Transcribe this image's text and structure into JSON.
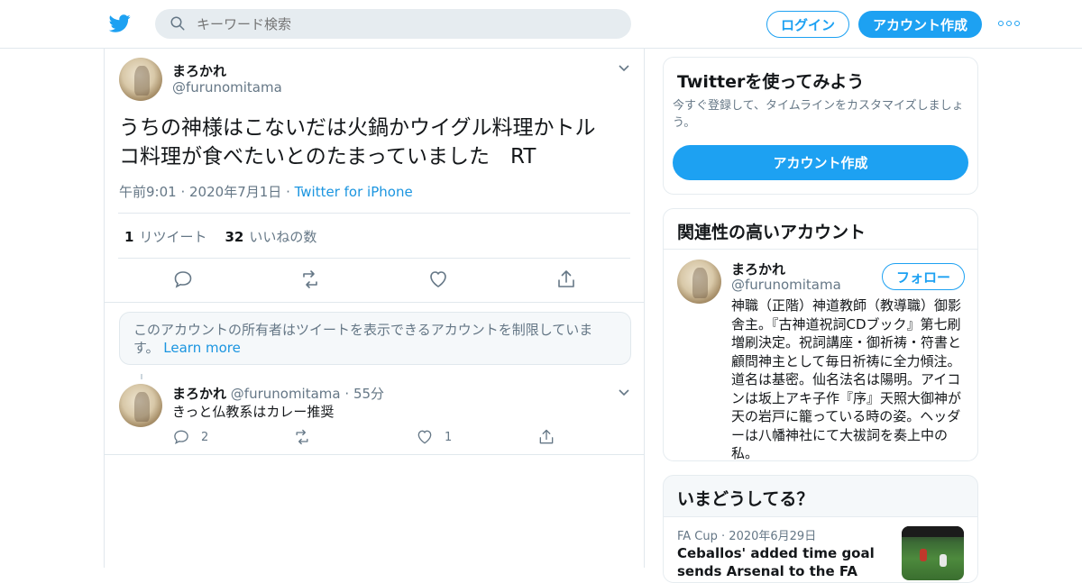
{
  "header": {
    "search_placeholder": "キーワード検索",
    "login_label": "ログイン",
    "signup_label": "アカウント作成"
  },
  "tweet": {
    "name": "まろかれ",
    "handle": "@furunomitama",
    "text_line1": "うちの神様はこないだは火鍋かウイグル料理かトル",
    "text_line2": "コ料理が食べたいとのたまっていました　RT",
    "time": "午前9:01",
    "date": "2020年7月1日",
    "source": "Twitter for iPhone",
    "retweet_count": "1",
    "retweet_label": "リツイート",
    "like_count": "32",
    "like_label": "いいねの数"
  },
  "notice": {
    "text": "このアカウントの所有者はツイートを表示できるアカウントを制限していま す。",
    "link": "Learn more"
  },
  "reply": {
    "name": "まろかれ",
    "handle": "@furunomitama",
    "time": "55分",
    "text": "きっと仏教系はカレー推奨",
    "reply_count": "2",
    "like_count": "1"
  },
  "signup_card": {
    "title": "Twitterを使ってみよう",
    "text": "今すぐ登録して、タイムラインをカスタマイズしましょう。",
    "button": "アカウント作成"
  },
  "related": {
    "title": "関連性の高いアカウント",
    "name": "まろかれ",
    "handle": "@furunomitama",
    "follow": "フォロー",
    "bio": "神職（正階）神道教師（教導職）御影舎主。『古神道祝詞CDブック』第七刷増刷決定。祝詞講座・御祈祷・符書と顧問神主として毎日祈祷に全力傾注。道名は基密。仙名法名は陽明。アイコンは坂上アキ子作『序』天照大御神が天の岩戸に籠っている時の姿。ヘッダーは八幡神社にて大祓詞を奏上中の私。"
  },
  "trends": {
    "title": "いまどうしてる？",
    "meta_source": "FA Cup",
    "meta_date": "2020年6月29日",
    "headline": "Ceballos' added time goal sends Arsenal to the FA Cup semi-finals"
  },
  "colors": {
    "accent": "#1da1f2",
    "link": "#1b95e0",
    "muted": "#657786",
    "border": "#e1e8ed"
  }
}
